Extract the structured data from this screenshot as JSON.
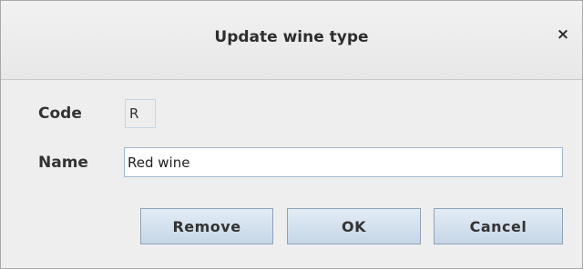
{
  "dialog": {
    "title": "Update wine type",
    "close_glyph": "×"
  },
  "form": {
    "code_label": "Code",
    "code_value": "R",
    "name_label": "Name",
    "name_value": "Red wine"
  },
  "buttons": {
    "remove": "Remove",
    "ok": "OK",
    "cancel": "Cancel"
  },
  "icons": {
    "close": "close-icon"
  }
}
